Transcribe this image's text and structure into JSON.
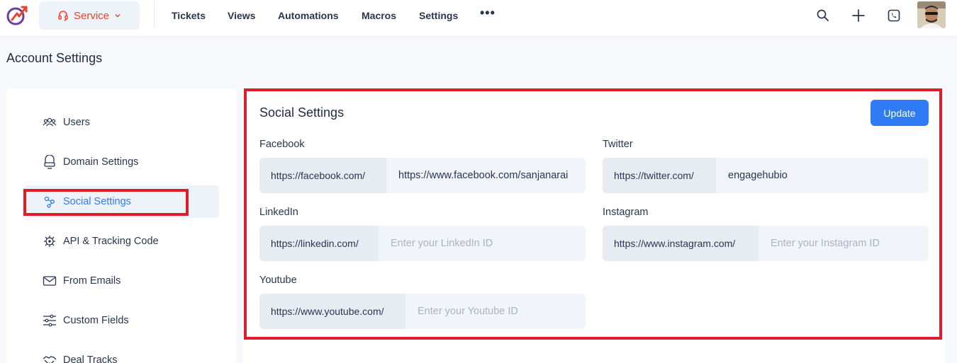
{
  "header": {
    "service_label": "Service",
    "nav": [
      "Tickets",
      "Views",
      "Automations",
      "Macros",
      "Settings"
    ],
    "more_label": "•••",
    "icons": [
      "search-icon",
      "plus-icon",
      "phone-icon"
    ]
  },
  "page": {
    "title": "Account Settings"
  },
  "sidebar": {
    "items": [
      {
        "label": "Users",
        "icon": "users-icon"
      },
      {
        "label": "Domain Settings",
        "icon": "domain-icon"
      },
      {
        "label": "Social Settings",
        "icon": "share-icon",
        "active": true
      },
      {
        "label": "API & Tracking Code",
        "icon": "api-icon"
      },
      {
        "label": "From Emails",
        "icon": "mail-icon"
      },
      {
        "label": "Custom Fields",
        "icon": "sliders-icon"
      },
      {
        "label": "Deal Tracks",
        "icon": "handshake-icon"
      }
    ]
  },
  "social": {
    "title": "Social Settings",
    "update_label": "Update",
    "fields": {
      "facebook": {
        "label": "Facebook",
        "prefix": "https://facebook.com/",
        "value": "https://www.facebook.com/sanjanarai",
        "placeholder": ""
      },
      "twitter": {
        "label": "Twitter",
        "prefix": "https://twitter.com/",
        "value": "engagehubio",
        "placeholder": ""
      },
      "linkedin": {
        "label": "LinkedIn",
        "prefix": "https://linkedin.com/",
        "value": "",
        "placeholder": "Enter your LinkedIn ID"
      },
      "instagram": {
        "label": "Instagram",
        "prefix": "https://www.instagram.com/",
        "value": "",
        "placeholder": "Enter your Instagram ID"
      },
      "youtube": {
        "label": "Youtube",
        "prefix": "https://www.youtube.com/",
        "value": "",
        "placeholder": "Enter your Youtube ID"
      }
    }
  },
  "colors": {
    "accent": "#2f7bf6",
    "brand": "#e8432d",
    "highlight": "#e01b2a"
  }
}
